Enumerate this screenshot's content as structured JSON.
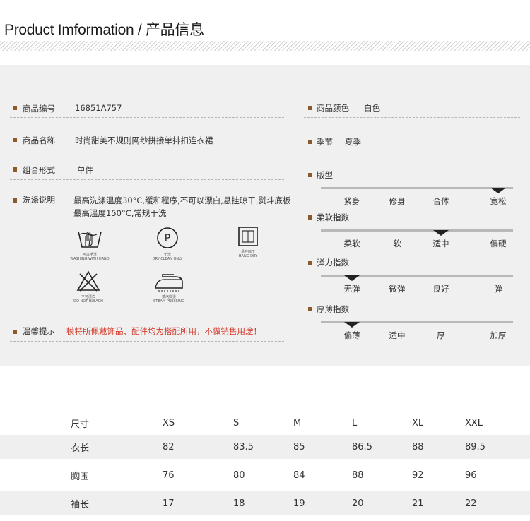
{
  "header": {
    "title": "Product Imformation / 产品信息"
  },
  "info": {
    "item_no_label": "商品编号",
    "item_no": "16851A757",
    "name_label": "商品名称",
    "name": "时尚甜美不规则网纱拼接单排扣连衣裙",
    "set_label": "组合形式",
    "set": "单件",
    "wash_label": "洗涤说明",
    "wash_text": "最高洗涤温度30°C,缓和程序,不可以漂白,悬挂晾干,熨斗底板最高温度150°C,常规干洗",
    "tip_label": "温馨提示",
    "tip_text": "模特所佩戴饰品、配件均为搭配所用，不做销售用途！",
    "color_label": "商品颜色",
    "color": "白色",
    "season_label": "季节",
    "season": "夏季"
  },
  "care_icons": [
    {
      "name": "hand-wash-icon",
      "cn": "可以手洗",
      "en": "WASHING WITH HAND"
    },
    {
      "name": "dry-clean-icon",
      "cn": "干洗",
      "en": "DRY CLEAN ONLY"
    },
    {
      "name": "hang-dry-icon",
      "cn": "悬挂晾干",
      "en": "HANG DRY"
    },
    {
      "name": "no-bleach-icon",
      "cn": "不可漂白",
      "en": "DO NOT BLEACH"
    },
    {
      "name": "steam-iron-icon",
      "cn": "蒸汽熨烫",
      "en": "STEAM PRESSING"
    }
  ],
  "scales": [
    {
      "label": "版型",
      "ticks": [
        "紧身",
        "修身",
        "合体",
        "宽松"
      ],
      "selected_index": 3
    },
    {
      "label": "柔软指数",
      "ticks": [
        "柔软",
        "软",
        "适中",
        "偏硬"
      ],
      "selected_index": 2
    },
    {
      "label": "弹力指数",
      "ticks": [
        "无弹",
        "微弹",
        "良好",
        "弹"
      ],
      "selected_index": 0
    },
    {
      "label": "厚薄指数",
      "ticks": [
        "偏薄",
        "适中",
        "厚",
        "加厚"
      ],
      "selected_index": 0
    }
  ],
  "size_table": {
    "header": [
      "尺寸",
      "XS",
      "S",
      "M",
      "L",
      "XL",
      "XXL"
    ],
    "rows": [
      [
        "衣长",
        "82",
        "83.5",
        "85",
        "86.5",
        "88",
        "89.5"
      ],
      [
        "胸围",
        "76",
        "80",
        "84",
        "88",
        "92",
        "96"
      ],
      [
        "袖长",
        "17",
        "18",
        "19",
        "20",
        "21",
        "22"
      ]
    ]
  }
}
